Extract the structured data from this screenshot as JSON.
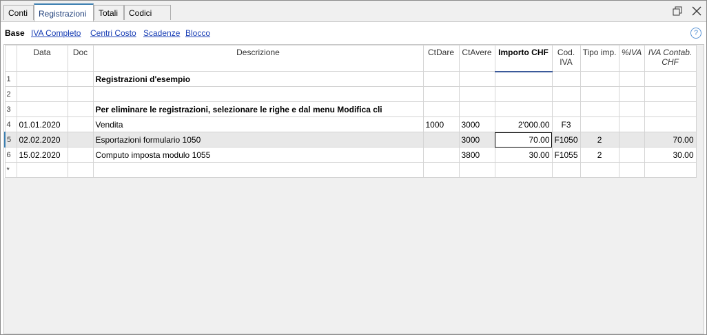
{
  "tabs": [
    "Conti",
    "Registrazioni",
    "Totali",
    "Codici IVA"
  ],
  "active_tab": "Registrazioni",
  "views": {
    "current": "Base",
    "links": [
      "IVA Completo",
      "Centri Costo",
      "Scadenze",
      "Blocco"
    ]
  },
  "help_label": "?",
  "columns": {
    "data": "Data",
    "doc": "Doc",
    "descrizione": "Descrizione",
    "ctdare": "CtDare",
    "ctavere": "CtAvere",
    "importo": "Importo CHF",
    "cod_iva_1": "Cod.",
    "cod_iva_2": "IVA",
    "tipo_imp": "Tipo imp.",
    "perc_iva": "%IVA",
    "iva_contab_1": "IVA Contab.",
    "iva_contab_2": "CHF"
  },
  "rows": [
    {
      "n": "1",
      "data": "",
      "doc": "",
      "desc": "Registrazioni d'esempio",
      "dare": "",
      "avere": "",
      "importo": "",
      "cod": "",
      "tipo": "",
      "perc": "",
      "ivac": ""
    },
    {
      "n": "2",
      "data": "",
      "doc": "",
      "desc": "",
      "dare": "",
      "avere": "",
      "importo": "",
      "cod": "",
      "tipo": "",
      "perc": "",
      "ivac": ""
    },
    {
      "n": "3",
      "data": "",
      "doc": "",
      "desc": "Per eliminare le registrazioni, selezionare le righe e dal menu Modifica cli",
      "dare": "",
      "avere": "",
      "importo": "",
      "cod": "",
      "tipo": "",
      "perc": "",
      "ivac": ""
    },
    {
      "n": "4",
      "data": "01.01.2020",
      "doc": "",
      "desc": "Vendita",
      "dare": "1000",
      "avere": "3000",
      "importo": "2'000.00",
      "cod": "F3",
      "tipo": "",
      "perc": "",
      "ivac": ""
    },
    {
      "n": "5",
      "data": "02.02.2020",
      "doc": "",
      "desc": "Esportazioni formulario 1050",
      "dare": "",
      "avere": "3000",
      "importo": "70.00",
      "cod": "F1050",
      "tipo": "2",
      "perc": "",
      "ivac": "70.00"
    },
    {
      "n": "6",
      "data": "15.02.2020",
      "doc": "",
      "desc": "Computo imposta modulo 1055",
      "dare": "",
      "avere": "3800",
      "importo": "30.00",
      "cod": "F1055",
      "tipo": "2",
      "perc": "",
      "ivac": "30.00"
    },
    {
      "n": "*",
      "data": "",
      "doc": "",
      "desc": "",
      "dare": "",
      "avere": "",
      "importo": "",
      "cod": "",
      "tipo": "",
      "perc": "",
      "ivac": ""
    }
  ]
}
